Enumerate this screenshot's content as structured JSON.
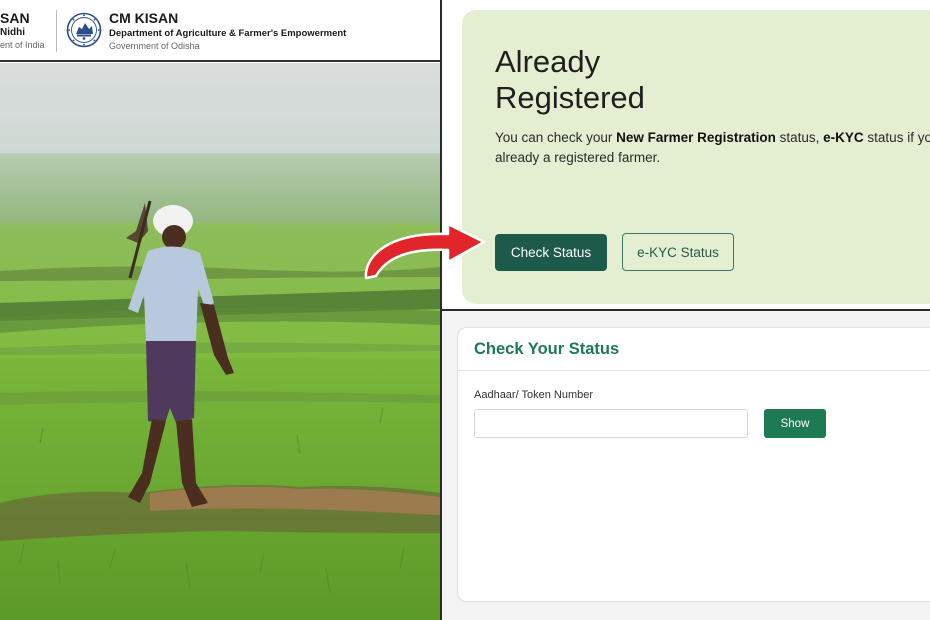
{
  "header": {
    "left_title": "SAN",
    "left_sub": "Nidhi",
    "left_gov": "ent of India",
    "right_title": "CM KISAN",
    "right_dept": "Department of Agriculture & Farmer's Empowerment",
    "right_gov": "Government of Odisha"
  },
  "registered_card": {
    "title_line1": "Already",
    "title_line2": "Registered",
    "desc_prefix": "You can check your ",
    "desc_bold1": "New Farmer Registration",
    "desc_mid": " status, ",
    "desc_bold2": "e-KYC",
    "desc_suffix": " status if you ar",
    "desc_line2": "already a registered farmer.",
    "check_status_label": "Check Status",
    "ekyc_status_label": "e-KYC Status"
  },
  "status_panel": {
    "title": "Check Your Status",
    "field_label": "Aadhaar/ Token Number",
    "field_value": "",
    "field_placeholder": "",
    "show_label": "Show"
  },
  "colors": {
    "card_bg": "#e4efd2",
    "primary_button": "#1d5a4a",
    "accent_green": "#1d7a52",
    "arrow_red": "#e1262b"
  },
  "icons": {
    "emblem": "odisha-emblem-icon",
    "arrow": "red-curved-arrow-icon"
  }
}
